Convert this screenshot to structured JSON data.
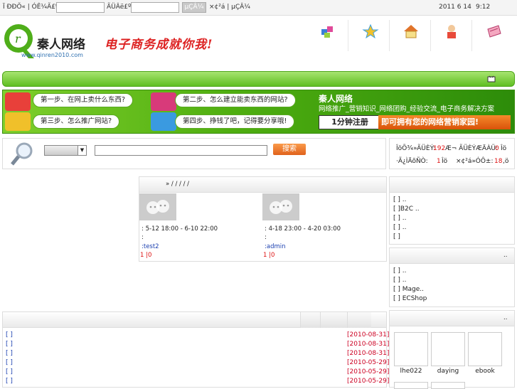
{
  "topbar": {
    "user_label": "Ï ÐÐÕ« | ÓÊ¼Ã£º",
    "pass_label": "ÃÜÂë£º",
    "login_btn": "µÇÂ¼",
    "links": "×¢²á | µÇÂ¼",
    "date": "2011 6 14",
    "time": "9:12"
  },
  "header": {
    "logo_cn": "秦人网络",
    "logo_url": "www.qinren2010.com",
    "slogan": "电子商务成就你我!"
  },
  "banner": {
    "step1": "第一步、在网上卖什么东西?",
    "step2": "第二步、怎么建立能卖东西的网站?",
    "step3": "第三步、怎么推广网站?",
    "step4": "第四步、挣钱了吧，记得要分享哦!",
    "brand_title": "秦人网络",
    "brand_sub": "网络推广_营销知识_网络团购_经验交流_电子商务解决方案",
    "register": "1分钟注册",
    "register_tail": "即可拥有您的网络营销家园!"
  },
  "search": {
    "button": "搜索"
  },
  "stats": {
    "l1a": "ÎöÕ¾»ÃÜÈÝ:",
    "l1b": "192",
    "l1c": "Æ¬  ÃÜÈÝÆÄÀÜ:",
    "l1d": "0",
    "l1e": "Îö",
    "l2a": "·Ã¿ÌÄõÑÒ:",
    "l2b": "1",
    "l2c": "Îö",
    "l2d": "×¢²á»ÓÔ±:",
    "l2e": "18",
    "l2f": ",ö"
  },
  "events": {
    "head": "»  /  /  /  /  /",
    "e1_time": ": 5-12 18:00 - 6-10 22:00",
    "e1_colon": ":",
    "e1_user": ":test2",
    "e1_stats": "1  |0",
    "e2_time": ": 4-18 23:00 - 4-20 03:00",
    "e2_colon": ":",
    "e2_user": ":admin",
    "e2_stats": "1  |0"
  },
  "right_top": {
    "items": [
      "[  ]          ..",
      "[  ]B2C      ..",
      "[  ]          ..",
      "[  ]          ..",
      "[  ]"
    ]
  },
  "right_mid": {
    "head": "..",
    "items": [
      "[  ]          ..",
      "[  ]          ..",
      "[  ]          Mage..",
      "[  ]          ECShop"
    ]
  },
  "right_bot": {
    "head": "..",
    "labels": [
      "lhe022",
      "daying",
      "ebook"
    ]
  },
  "news": {
    "rows": [
      {
        "t": "[  ]",
        "d": "[2010-08-31]"
      },
      {
        "t": "[  ]",
        "d": "[2010-08-31]"
      },
      {
        "t": "[  ]",
        "d": "[2010-08-31]"
      },
      {
        "t": "[  ]",
        "d": "[2010-05-29]"
      },
      {
        "t": "[  ]",
        "d": "[2010-05-29]"
      },
      {
        "t": "[  ]",
        "d": "[2010-05-29]"
      }
    ]
  }
}
